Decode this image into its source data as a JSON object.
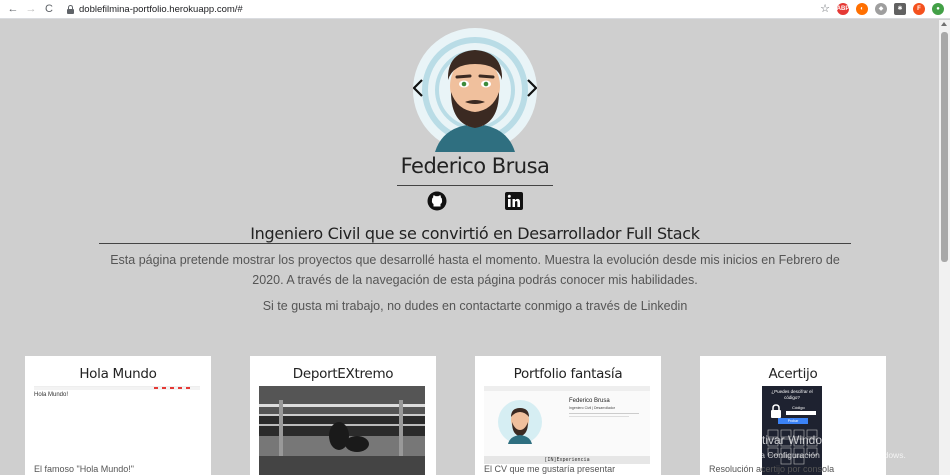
{
  "browser": {
    "url": "doblefilmina-portfolio.herokuapp.com/#"
  },
  "profile": {
    "name": "Federico Brusa",
    "headline": "Ingeniero Civil que se convirtió en Desarrollador Full Stack",
    "intro": "Esta página pretende mostrar los proyectos que desarrollé hasta el momento. Muestra la evolución desde mis inicios en Febrero de 2020. A través de la navegación de esta página podrás conocer mis habilidades.",
    "contact": "Si te gusta mi trabajo, no dudes en contactarte conmigo a través de Linkedin"
  },
  "projects": [
    {
      "title": "Hola Mundo",
      "description": "El famoso \"Hola Mundo!\"",
      "preview_text": "Hola Mundo!"
    },
    {
      "title": "DeportEXtremo",
      "description": "",
      "preview_text": ""
    },
    {
      "title": "Portfolio fantasía",
      "description": "El CV que me gustaría presentar",
      "preview_text": "Federico Brusa",
      "preview_subtext": "Ingeniero Civil | Desarrollador",
      "preview_section": "[IN]Experiencia"
    },
    {
      "title": "Acertijo",
      "description": "Resolución acertijo por consola",
      "preview_text": "¿Puedes descifrar el código?",
      "preview_label": "Código",
      "preview_button": "Probar"
    }
  ],
  "watermark": {
    "title": "Activar Windows",
    "subtitle": "Ve a Configuración para activar Windows."
  }
}
